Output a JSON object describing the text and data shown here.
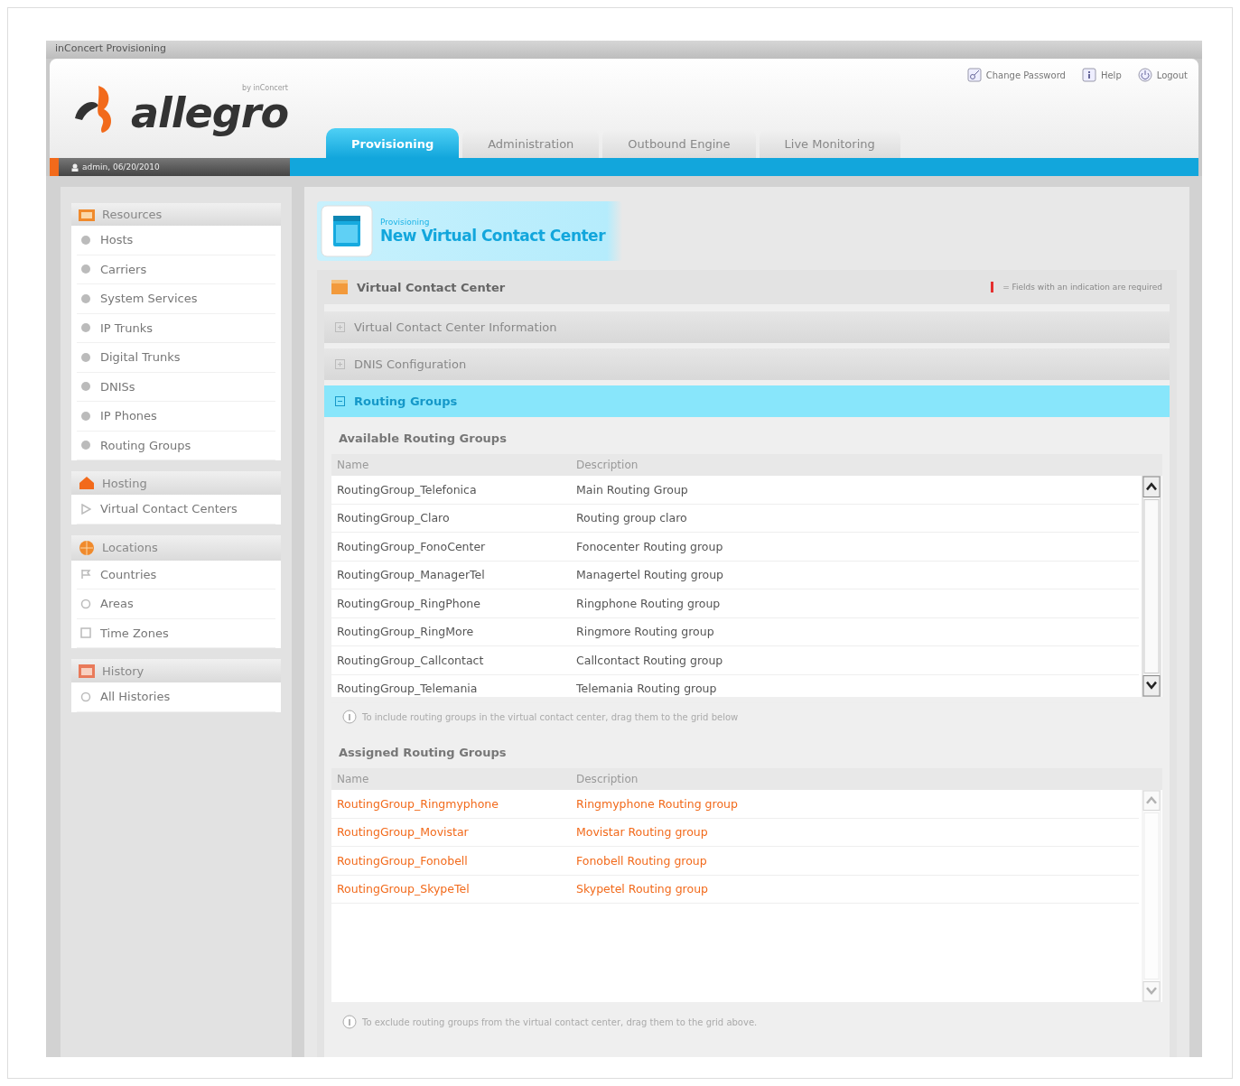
{
  "window": {
    "title": "inConcert Provisioning"
  },
  "logo": {
    "name": "allegro",
    "tagline": "by inConcert"
  },
  "user": {
    "label": "admin, 06/20/2010"
  },
  "top_links": [
    {
      "label": "Change Password",
      "kind": "password"
    },
    {
      "label": "Help",
      "kind": "help"
    },
    {
      "label": "Logout",
      "kind": "logout"
    }
  ],
  "tabs": [
    {
      "label": "Provisioning",
      "selected": true
    },
    {
      "label": "Administration",
      "selected": false
    },
    {
      "label": "Outbound Engine",
      "selected": false
    },
    {
      "label": "Live Monitoring",
      "selected": false
    }
  ],
  "sidebar": {
    "groups": [
      {
        "title": "Resources",
        "kind": "resources",
        "items": [
          {
            "label": "Hosts",
            "kind": "dot"
          },
          {
            "label": "Carriers",
            "kind": "dot"
          },
          {
            "label": "System Services",
            "kind": "dot"
          },
          {
            "label": "IP Trunks",
            "kind": "dot"
          },
          {
            "label": "Digital Trunks",
            "kind": "dot"
          },
          {
            "label": "DNISs",
            "kind": "dot"
          },
          {
            "label": "IP Phones",
            "kind": "dot"
          },
          {
            "label": "Routing Groups",
            "kind": "dot"
          }
        ]
      },
      {
        "title": "Hosting",
        "kind": "hosting",
        "items": [
          {
            "label": "Virtual Contact Centers",
            "kind": "play"
          }
        ]
      },
      {
        "title": "Locations",
        "kind": "locations",
        "items": [
          {
            "label": "Countries",
            "kind": "flag"
          },
          {
            "label": "Areas",
            "kind": "circle"
          },
          {
            "label": "Time Zones",
            "kind": "square"
          }
        ]
      },
      {
        "title": "History",
        "kind": "history",
        "items": [
          {
            "label": "All Histories",
            "kind": "circle"
          }
        ]
      }
    ]
  },
  "page_header": {
    "subtitle": "Provisioning",
    "title": "New Virtual Contact Center"
  },
  "panel": {
    "title": "Virtual Contact Center",
    "required_note": "= Fields with an indication are required",
    "sections": [
      {
        "title": "Virtual Contact Center Information",
        "expanded": false
      },
      {
        "title": "DNIS Configuration",
        "expanded": false
      },
      {
        "title": "Routing Groups",
        "expanded": true
      }
    ]
  },
  "available": {
    "title": "Available Routing Groups",
    "columns": [
      "Name",
      "Description"
    ],
    "rows": [
      [
        "RoutingGroup_Telefonica",
        "Main Routing Group"
      ],
      [
        "RoutingGroup_Claro",
        "Routing group claro"
      ],
      [
        "RoutingGroup_FonoCenter",
        "Fonocenter Routing group"
      ],
      [
        "RoutingGroup_ManagerTel",
        "Managertel Routing group"
      ],
      [
        "RoutingGroup_RingPhone",
        "Ringphone Routing group"
      ],
      [
        "RoutingGroup_RingMore",
        "Ringmore Routing group"
      ],
      [
        "RoutingGroup_Callcontact",
        "Callcontact Routing group"
      ],
      [
        "RoutingGroup_Telemania",
        "Telemania Routing group"
      ]
    ],
    "hint": "To include routing groups in the virtual contact center, drag them to the grid below"
  },
  "assigned": {
    "title": "Assigned Routing Groups",
    "columns": [
      "Name",
      "Description"
    ],
    "rows": [
      [
        "RoutingGroup_Ringmyphone",
        "Ringmyphone Routing group"
      ],
      [
        "RoutingGroup_Movistar",
        "Movistar Routing group"
      ],
      [
        "RoutingGroup_Fonobell",
        "Fonobell Routing group"
      ],
      [
        "RoutingGroup_SkypeTel",
        "Skypetel Routing group"
      ]
    ],
    "hint": "To exclude routing groups from the virtual contact center, drag them to the grid above."
  }
}
